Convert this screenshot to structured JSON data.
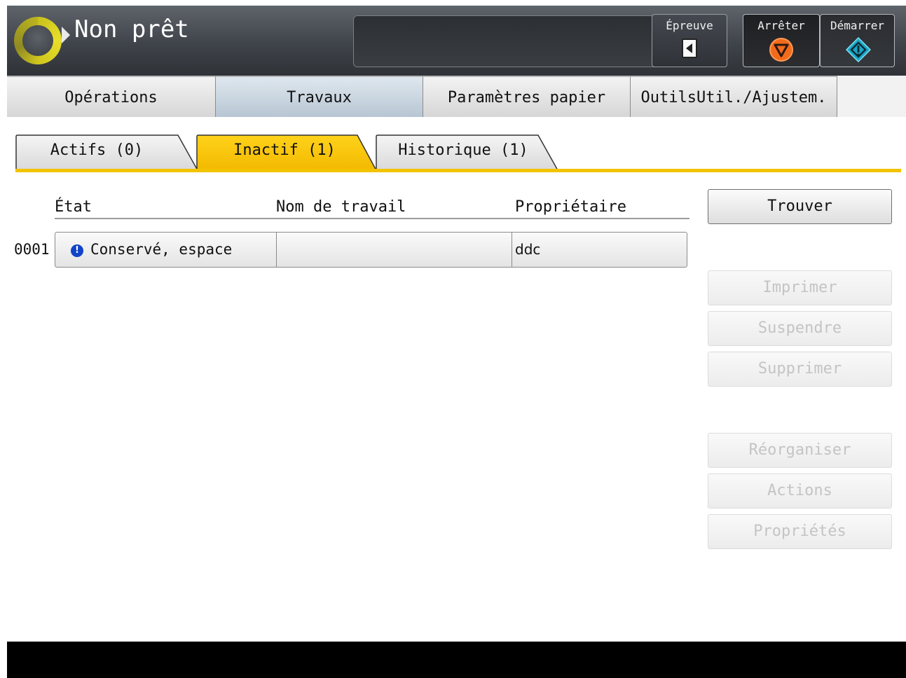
{
  "header": {
    "status_title": "Non prêt",
    "message": "",
    "buttons": {
      "epreuve": "Épreuve",
      "arreter": "Arrêter",
      "demarrer": "Démarrer"
    },
    "colors": {
      "ring": "#e8df2a",
      "stop": "#f26a1b",
      "start": "#1aa6c8"
    }
  },
  "main_tabs": [
    {
      "label": "Opérations"
    },
    {
      "label": "Travaux",
      "selected": true
    },
    {
      "label": "Paramètres papier"
    },
    {
      "label": "OutilsUtil./Ajustem."
    }
  ],
  "sub_tabs": [
    {
      "label": "Actifs (0)"
    },
    {
      "label": "Inactif (1)",
      "selected": true
    },
    {
      "label": "Historique (1)"
    }
  ],
  "table": {
    "headers": {
      "etat": "État",
      "nom": "Nom de travail",
      "proprietaire": "Propriétaire"
    },
    "rows": [
      {
        "index": "0001",
        "etat": "Conservé, espace",
        "nom": "",
        "proprietaire": "ddc",
        "icon": "info-icon"
      }
    ]
  },
  "side_buttons": {
    "trouver": "Trouver",
    "imprimer": "Imprimer",
    "suspendre": "Suspendre",
    "supprimer": "Supprimer",
    "reorganiser": "Réorganiser",
    "actions": "Actions",
    "proprietes": "Propriétés"
  },
  "accent_color": "#f2c400"
}
